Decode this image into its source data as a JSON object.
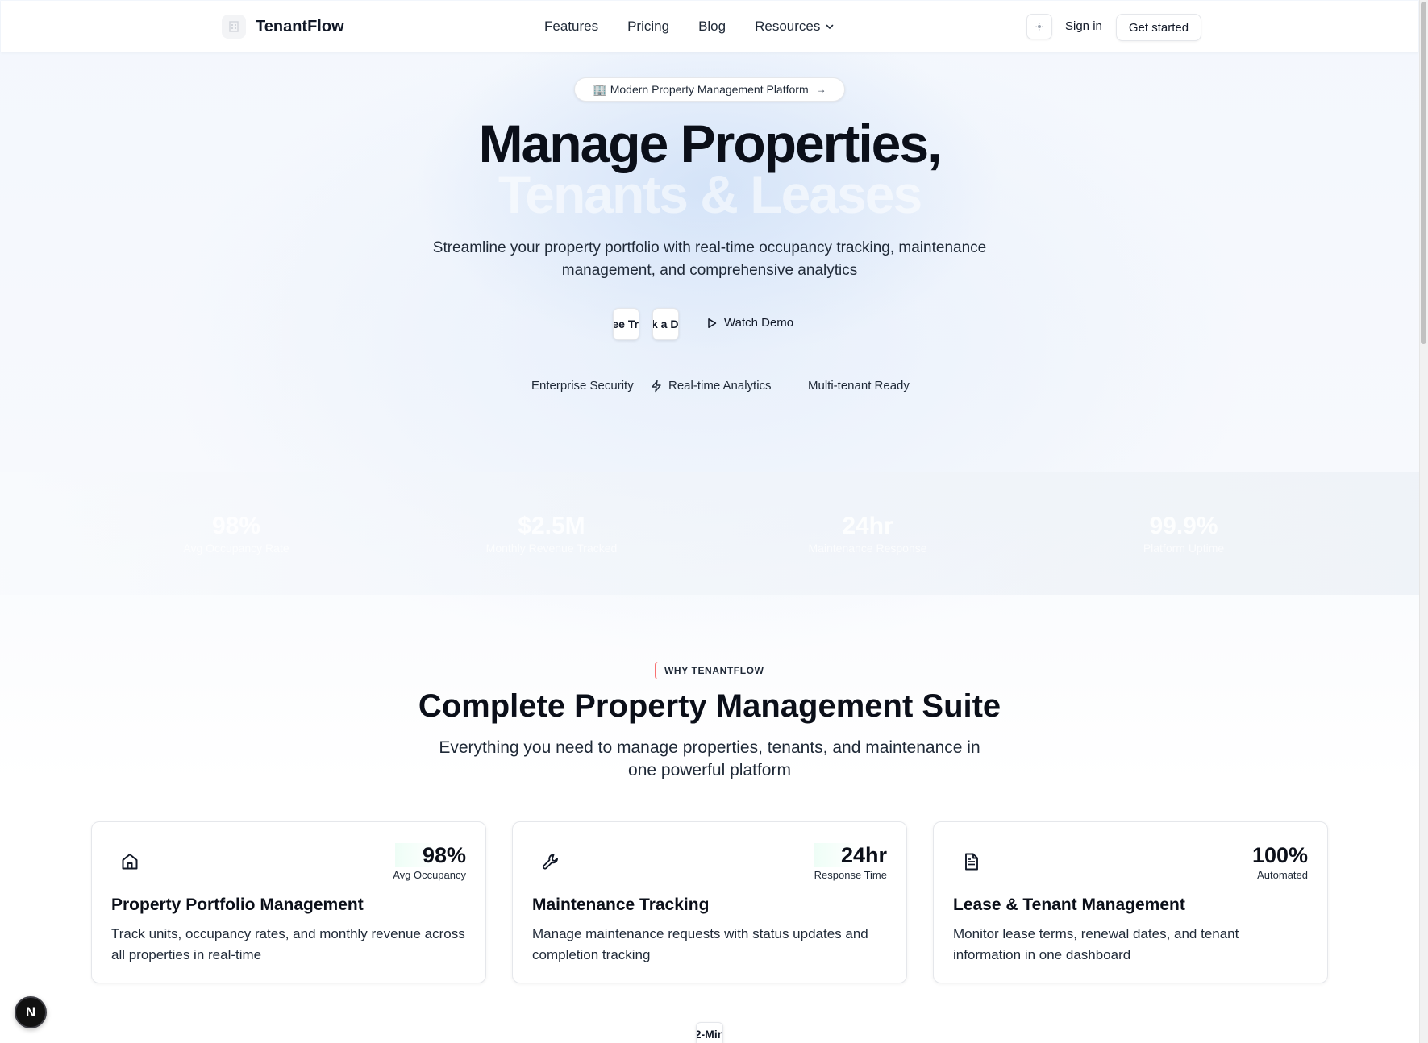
{
  "brand": {
    "name": "TenantFlow",
    "logo_icon": "building-icon"
  },
  "nav": {
    "items": [
      "Features",
      "Pricing",
      "Blog",
      "Resources"
    ],
    "resources_icon": "chevron-down-icon",
    "theme_icon": "sun-icon",
    "sign_in": "Sign in",
    "get_started": "Get started"
  },
  "hero": {
    "badge": "🏢 Modern Property Management Platform",
    "badge_arrow": "→",
    "title_line1": "Manage Properties,",
    "title_line2": "Tenants & Leases",
    "subtitle": "Streamline your property portfolio with real-time occupancy tracking, maintenance management, and comprehensive analytics",
    "cta_primary": "Free Trial",
    "cta_secondary": "Book a Demo",
    "watch_demo": "Watch Demo",
    "features": [
      "Enterprise Security",
      "Real-time Analytics",
      "Multi-tenant Ready"
    ]
  },
  "stats": [
    {
      "value": "98%",
      "label": "Avg Occupancy Rate"
    },
    {
      "value": "$2.5M",
      "label": "Monthly Revenue Tracked"
    },
    {
      "value": "24hr",
      "label": "Maintenance Response"
    },
    {
      "value": "99.9%",
      "label": "Platform Uptime"
    }
  ],
  "why": {
    "badge": "WHY TENANTFLOW",
    "title": "Complete Property Management Suite",
    "subtitle": "Everything you need to manage properties, tenants, and maintenance in one powerful platform"
  },
  "cards": [
    {
      "icon": "home-icon",
      "metric_value": "98%",
      "metric_label": "Avg Occupancy",
      "title": "Property Portfolio Management",
      "description": "Track units, occupancy rates, and monthly revenue across all properties in real-time"
    },
    {
      "icon": "wrench-icon",
      "metric_value": "24hr",
      "metric_label": "Response Time",
      "title": "Maintenance Tracking",
      "description": "Manage maintenance requests with status updates and completion tracking"
    },
    {
      "icon": "document-icon",
      "metric_value": "100%",
      "metric_label": "Automated",
      "title": "Lease & Tenant Management",
      "description": "Monitor lease terms, renewal dates, and tenant information in one dashboard"
    }
  ],
  "bottom_chip": "2-Min",
  "dev_badge": "N"
}
